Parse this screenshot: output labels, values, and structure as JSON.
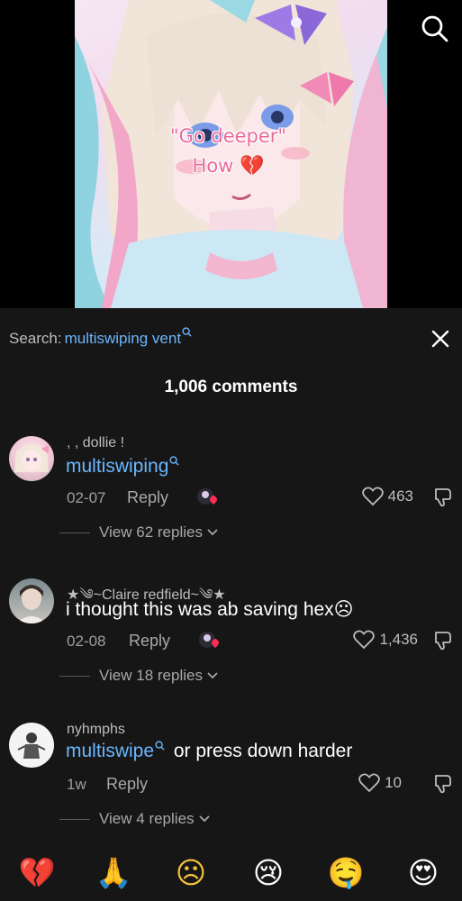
{
  "video": {
    "overlay_line1": "\"Go deeper\"",
    "overlay_line2": "How",
    "overlay_emoji": "💔",
    "search_icon": "search-icon"
  },
  "sheet": {
    "search_label": "Search:",
    "search_term": "multiswiping vent",
    "comment_count": "1,006 comments",
    "close_icon": "close-icon"
  },
  "comments": [
    {
      "username": ", , dollie !",
      "text_tag": "multiswiping",
      "text_rest": "",
      "date": "02-07",
      "reply_label": "Reply",
      "likes": "463",
      "view_replies": "View 62 replies"
    },
    {
      "username": "★༄~Claire redfield~༄★",
      "text_tag": "",
      "text_rest": "i thought this was ab saving hex☹",
      "date": "02-08",
      "reply_label": "Reply",
      "likes": "1,436",
      "view_replies": "View 18 replies"
    },
    {
      "username": "nyhmphs",
      "text_tag": "multiswipe",
      "text_rest": "or press down harder",
      "date": "1w",
      "reply_label": "Reply",
      "likes": "10",
      "view_replies": "View 4 replies"
    }
  ],
  "emoji_bar": [
    "💔",
    "🙏",
    "☹",
    "😢",
    "🤤",
    "😍"
  ],
  "colors": {
    "accent_link": "#6ab6ff",
    "background": "#161616",
    "overlay_pink": "#e96a9a"
  }
}
